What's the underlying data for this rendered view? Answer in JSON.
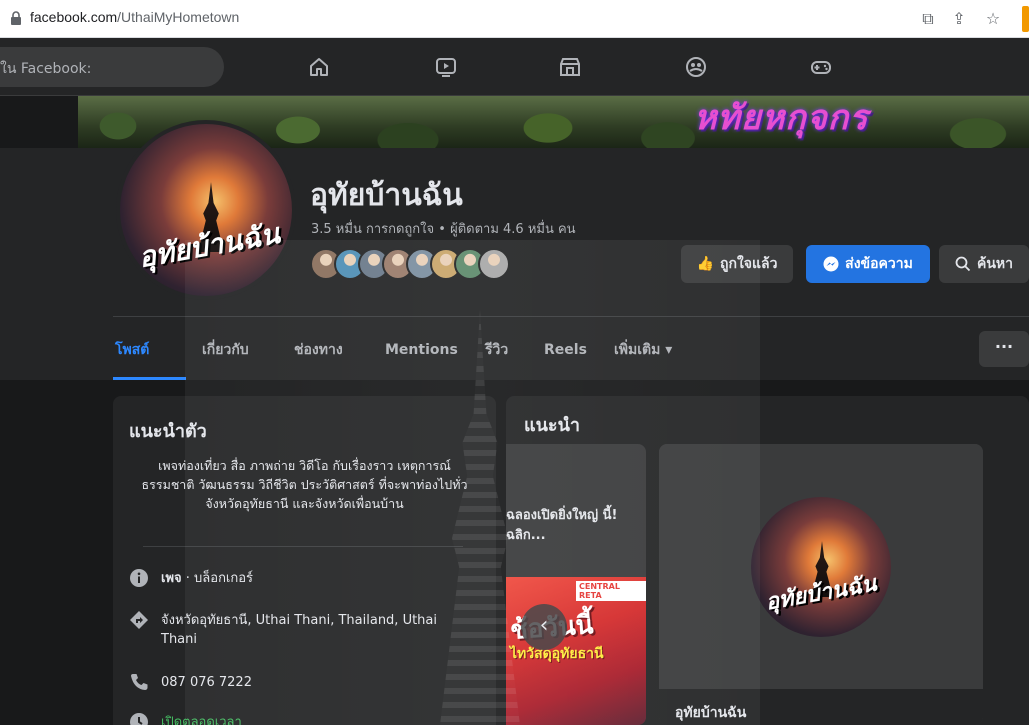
{
  "browser": {
    "url_host": "facebook.com",
    "url_path": "/UthaiMyHometown"
  },
  "nav": {
    "search_text": "ใน Facebook:",
    "icons": [
      "home-icon",
      "watch-icon",
      "marketplace-icon",
      "groups-icon",
      "gaming-icon"
    ]
  },
  "cover": {
    "text": "หทัยหกุจกร"
  },
  "profile": {
    "name": "อุทัยบ้านฉัน",
    "stats": "3.5 หมื่น การกดถูกใจ • ผู้ติดตาม 4.6 หมื่น คน",
    "avatar_text": "อุทัยบ้านฉัน",
    "friend_colors": [
      "#8a6f5c",
      "#4f8fb5",
      "#6b7a8a",
      "#9a7b6a",
      "#7b8ea0",
      "#c9a66b",
      "#5e8b6c",
      "#a8a8a8"
    ]
  },
  "actions": {
    "like_label": "ถูกใจแล้ว",
    "message_label": "ส่งข้อความ",
    "search_label": "ค้นหา"
  },
  "tabs": [
    {
      "label": "โพสต์",
      "active": true
    },
    {
      "label": "เกี่ยวกับ"
    },
    {
      "label": "ช่องทาง"
    },
    {
      "label": "Mentions"
    },
    {
      "label": "รีวิว"
    },
    {
      "label": "Reels"
    },
    {
      "label": "เพิ่มเติม ▾"
    }
  ],
  "more_button": "···",
  "intro": {
    "title": "แนะนำตัว",
    "bio": "เพจท่องเที่ยว สื่อ ภาพถ่าย วิดีโอ กับเรื่องราว เหตุการณ์ ธรรมชาติ วัฒนธรรม วิถีชีวิต ประวัติศาสตร์ ที่จะพาท่องไปทั่วจังหวัดอุทัยธานี และจังหวัดเพื่อนบ้าน",
    "category_bold": "เพจ",
    "category_rest": " · บล็อกเกอร์",
    "address": "จังหวัดอุทัยธานี, Uthai Thani, Thailand, Uthai Thani",
    "phone": "087 076 7222",
    "status": "เปิดตลอดเวลา"
  },
  "recommend": {
    "title": "แนะนำ",
    "card1_text": "ฉลองเปิดยิ่งใหญ่ นี้! ฉลิก...",
    "card1_promo": "ช้อวันนี้",
    "card1_promo2": "ไทวัสดุอุทัยธานี",
    "card1_brand": "CENTRAL RETA",
    "card2_name": "อุทัยบ้านฉัน",
    "card2_avatar_text": "อุทัยบ้านฉัน"
  }
}
